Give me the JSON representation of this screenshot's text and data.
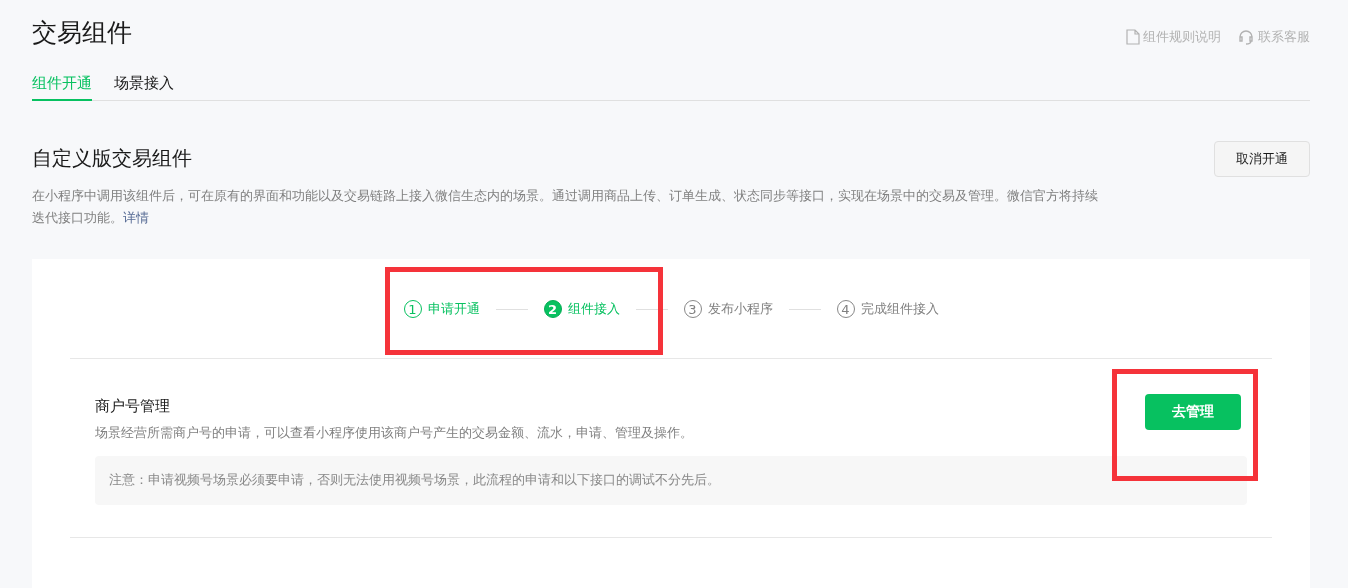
{
  "page_title": "交易组件",
  "header_links": [
    {
      "kind": "document",
      "label": "组件规则说明"
    },
    {
      "kind": "support",
      "label": "联系客服"
    }
  ],
  "tabs": [
    {
      "label": "组件开通",
      "selected": true
    },
    {
      "label": "场景接入",
      "selected": false
    }
  ],
  "component": {
    "title": "自定义版交易组件",
    "cancel_button": "取消开通",
    "description": "在小程序中调用该组件后，可在原有的界面和功能以及交易链路上接入微信生态内的场景。通过调用商品上传、订单生成、状态同步等接口，实现在场景中的交易及管理。微信官方将持续迭代接口功能。",
    "details_link": "详情"
  },
  "steps": [
    {
      "number": "1",
      "label": "申请开通",
      "completed": true,
      "current": false
    },
    {
      "number": "2",
      "label": "组件接入",
      "completed": false,
      "current": true
    },
    {
      "number": "3",
      "label": "发布小程序",
      "completed": false,
      "current": false
    },
    {
      "number": "4",
      "label": "完成组件接入",
      "completed": false,
      "current": false
    }
  ],
  "steps_highlighted": true,
  "sections": [
    {
      "title": "商户号管理",
      "description": "场景经营所需商户号的申请，可以查看小程序使用该商户号产生的交易金额、流水，申请、管理及操作。",
      "note": "注意：申请视频号场景必须要申请，否则无法使用视频号场景，此流程的申请和以下接口的调试不分先后。",
      "button": "去管理",
      "button_highlighted": true
    }
  ]
}
